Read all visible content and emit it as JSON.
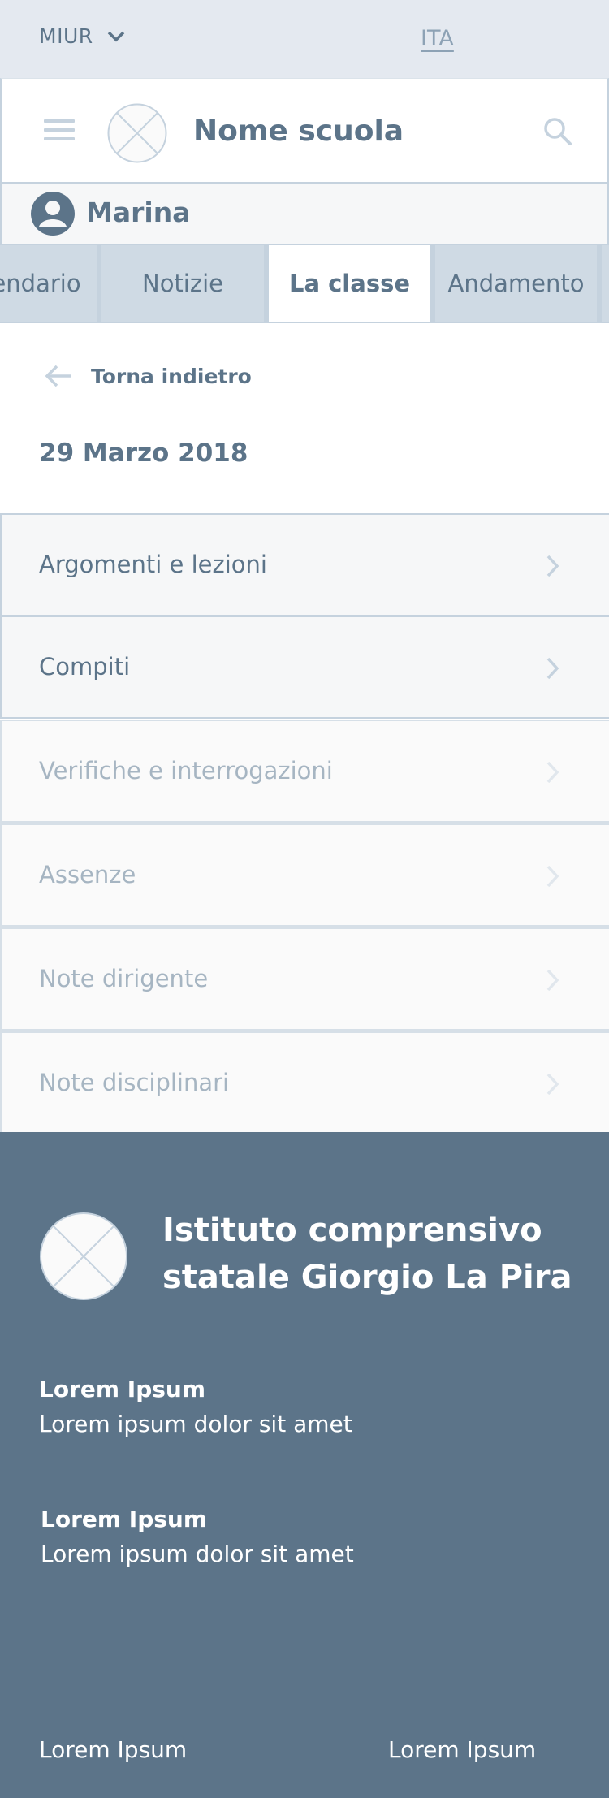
{
  "topbar": {
    "org": "MIUR",
    "lang": "ITA"
  },
  "header": {
    "school_name": "Nome scuola"
  },
  "user": {
    "name": "Marina"
  },
  "tabs": [
    {
      "label": "endario"
    },
    {
      "label": "Notizie"
    },
    {
      "label": "La classe"
    },
    {
      "label": "Andamento"
    },
    {
      "label": ""
    }
  ],
  "back": {
    "label": "Torna indietro"
  },
  "date": "29 Marzo 2018",
  "menu": [
    {
      "label": "Argomenti e lezioni"
    },
    {
      "label": "Compiti"
    },
    {
      "label": "Verifiche e interrogazioni"
    },
    {
      "label": "Assenze"
    },
    {
      "label": "Note dirigente"
    },
    {
      "label": "Note disciplinari"
    }
  ],
  "footer": {
    "institute": "Istituto comprensivo statale Giorgio La Pira",
    "blocks": [
      {
        "heading": "Lorem Ipsum",
        "text": "Lorem ipsum dolor sit amet"
      },
      {
        "heading": "Lorem Ipsum",
        "text": "Lorem ipsum dolor sit amet"
      }
    ],
    "links": [
      "Lorem Ipsum",
      "Lorem Ipsum"
    ]
  },
  "colors": {
    "primary": "#5c7489",
    "light_bg": "#e4e9f0",
    "border": "#c5d2de",
    "muted_text": "#a6b5c2"
  },
  "icons": [
    "chevron-down-icon",
    "hamburger-menu-icon",
    "logo-placeholder-icon",
    "search-icon",
    "user-avatar-icon",
    "arrow-left-icon",
    "chevron-right-icon"
  ]
}
